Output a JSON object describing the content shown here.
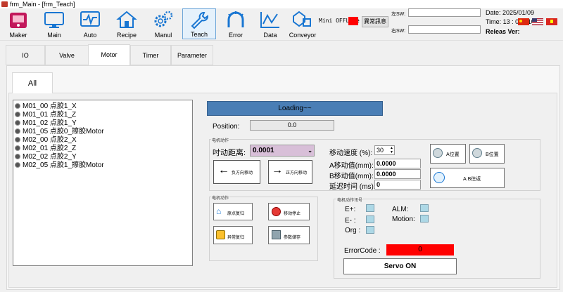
{
  "window": {
    "title": "frm_Main - [frm_Teach]"
  },
  "toolbar": {
    "items": [
      {
        "label": "Maker",
        "icon": "maker-icon"
      },
      {
        "label": "Main",
        "icon": "monitor-icon"
      },
      {
        "label": "Auto",
        "icon": "auto-icon"
      },
      {
        "label": "Recipe",
        "icon": "recipe-icon"
      },
      {
        "label": "Manul",
        "icon": "gears-icon"
      },
      {
        "label": "Teach",
        "icon": "wrench-icon"
      },
      {
        "label": "Error",
        "icon": "error-icon"
      },
      {
        "label": "Data",
        "icon": "chart-icon"
      },
      {
        "label": "Conveyor",
        "icon": "conveyor-icon"
      }
    ],
    "active": "Teach"
  },
  "status": {
    "mini_label": "Mini OFFLine",
    "mini_color": "#ff0000",
    "alarm_button": "異常訊息",
    "left_sw_label": "左SW:",
    "right_sw_label": "右SW:",
    "left_sw_value": "",
    "right_sw_value": "",
    "date_label": "Date: 2025/01/09",
    "time_label": "Time: 13 : 08 : 10",
    "release_label": "Releas Ver:"
  },
  "tabs": [
    "IO",
    "Valve",
    "Motor",
    "Timer",
    "Parameter"
  ],
  "active_tab": "Motor",
  "sub_tab": "All",
  "motors": [
    "M01_00 点胶1_X",
    "M01_01 点胶1_Z",
    "M01_02 点胶1_Y",
    "M01_05 点胶0_擦胶Motor",
    "M02_00 点胶2_X",
    "M02_01 点胶2_Z",
    "M02_02 点胶2_Y",
    "M02_05 点胶1_擦胶Motor"
  ],
  "loading_text": "Loading~~",
  "position": {
    "label": "Position:",
    "value": "0.0"
  },
  "motion": {
    "group_title": "电机动作",
    "jog_label": "吋动距离:",
    "jog_value": "0.0001",
    "neg_button": "负方向移动",
    "pos_button": "正方向移动",
    "speed_label": "移动速度 (%):",
    "speed_value": "30",
    "a_label": "A移动值(mm):",
    "a_value": "0.0000",
    "b_label": "B移动值(mm):",
    "b_value": "0.0000",
    "delay_label": "延迟时间 (ms):",
    "delay_value": "0",
    "a_pos_button": "A位置",
    "b_pos_button": "B位置",
    "ab_button": "A.B往返"
  },
  "actions": {
    "group_title": "电机动作",
    "home_button": "原点复归",
    "stop_button": "移动停止",
    "alarm_reset_button": "异常复归",
    "save_button": "参数储存"
  },
  "signals": {
    "group_title": "电机动作讯号",
    "e_plus": "E+:",
    "e_minus": "E- :",
    "org": "Org :",
    "alm": "ALM:",
    "motion": "Motion:",
    "error_code_label": "ErrorCode :",
    "error_code_value": "0",
    "error_color": "#ff0000",
    "servo_button": "Servo ON"
  }
}
